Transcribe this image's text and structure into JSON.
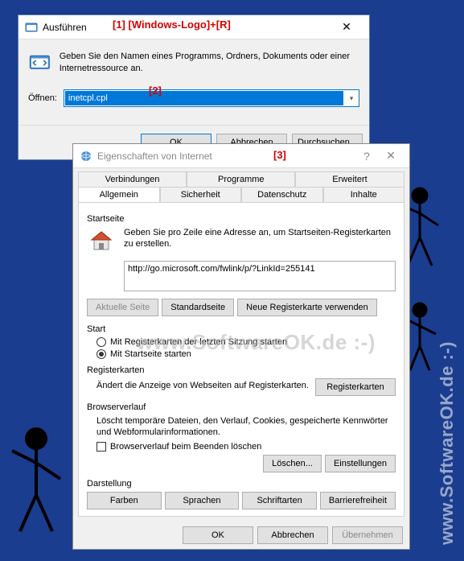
{
  "run": {
    "title": "Ausführen",
    "description": "Geben Sie den Namen eines Programms, Ordners, Dokuments oder einer Internetressource an.",
    "open_label": "Öffnen:",
    "input_value": "inetcpl.cpl",
    "ok": "OK",
    "cancel": "Abbrechen",
    "browse": "Durchsuchen..."
  },
  "annotations": {
    "a1": "[1] [Windows-Logo]+[R]",
    "a2": "[2]",
    "a3": "[3]"
  },
  "props": {
    "title": "Eigenschaften von Internet",
    "tabs_row1": [
      "Verbindungen",
      "Programme",
      "Erweitert"
    ],
    "tabs_row2": [
      "Allgemein",
      "Sicherheit",
      "Datenschutz",
      "Inhalte"
    ],
    "active_tab": "Allgemein",
    "startpage": {
      "label": "Startseite",
      "text": "Geben Sie pro Zeile eine Adresse an, um Startseiten-Registerkarten zu erstellen.",
      "url": "http://go.microsoft.com/fwlink/p/?LinkId=255141",
      "btn_current": "Aktuelle Seite",
      "btn_default": "Standardseite",
      "btn_newtab": "Neue Registerkarte verwenden"
    },
    "start": {
      "label": "Start",
      "radio1": "Mit Registerkarten der letzten Sitzung starten",
      "radio2": "Mit Startseite starten"
    },
    "tabsgroup": {
      "label": "Registerkarten",
      "text": "Ändert die Anzeige von Webseiten auf Registerkarten.",
      "btn": "Registerkarten"
    },
    "history": {
      "label": "Browserverlauf",
      "text": "Löscht temporäre Dateien, den Verlauf, Cookies, gespeicherte Kennwörter und Webformularinformationen.",
      "check": "Browserverlauf beim Beenden löschen",
      "btn_delete": "Löschen...",
      "btn_settings": "Einstellungen"
    },
    "appearance": {
      "label": "Darstellung",
      "btn_colors": "Farben",
      "btn_lang": "Sprachen",
      "btn_fonts": "Schriftarten",
      "btn_access": "Barrierefreiheit"
    },
    "footer": {
      "ok": "OK",
      "cancel": "Abbrechen",
      "apply": "Übernehmen"
    }
  },
  "watermark": "www.SoftwareOK.de  :-)"
}
